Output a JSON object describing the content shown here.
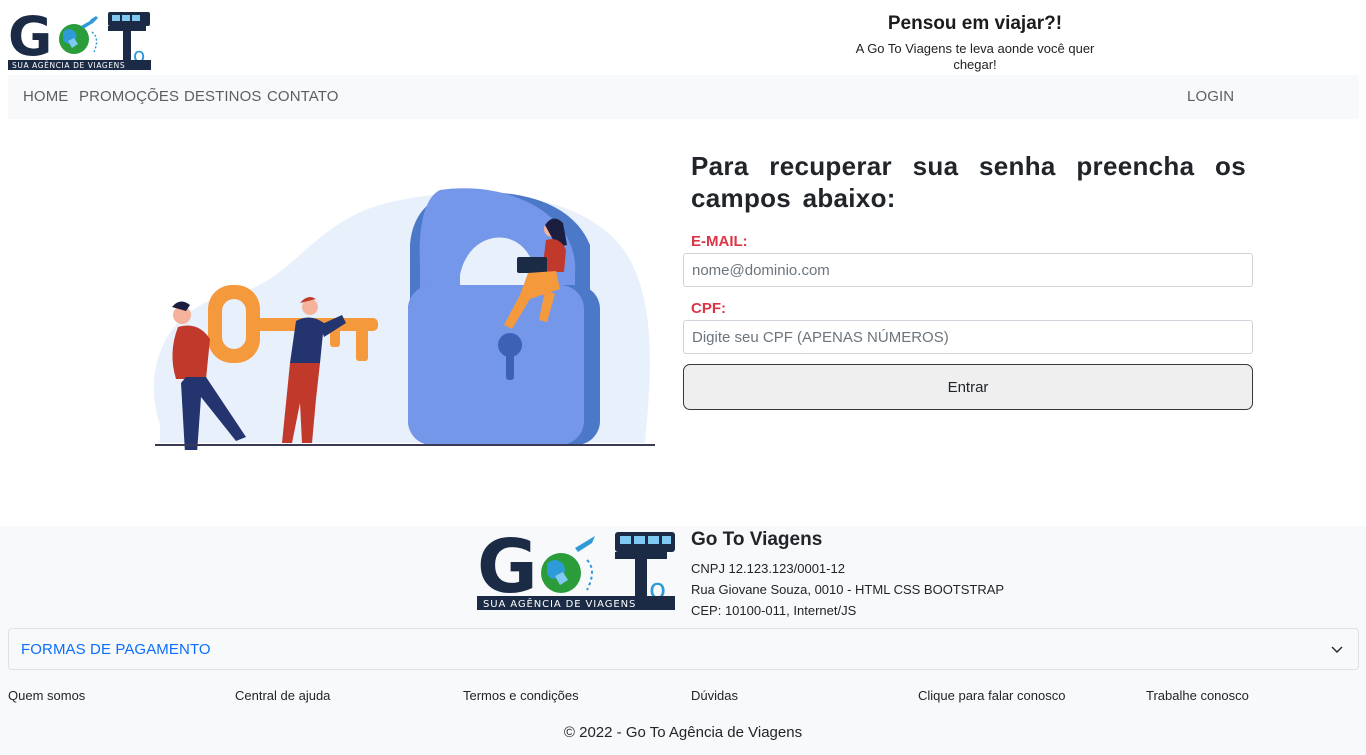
{
  "header": {
    "logo_text": "SUA AGÊNCIA DE VIAGENS",
    "logo_letters": "GoTo",
    "tagline_title": "Pensou em viajar?!",
    "tagline_subtitle": "A Go To Viagens te leva aonde você quer chegar!"
  },
  "nav": {
    "items": [
      "HOME",
      "PROMOÇÕES",
      "DESTINOS",
      "CONTATO"
    ],
    "login": "LOGIN"
  },
  "form": {
    "title": "Para recuperar sua senha preencha os campos abaixo:",
    "email_label": "E-MAIL:",
    "email_placeholder": "nome@dominio.com",
    "cpf_label": "CPF:",
    "cpf_placeholder": "Digite seu CPF (APENAS NÚMEROS)",
    "submit_label": "Entrar"
  },
  "footer": {
    "company_name": "Go To Viagens",
    "cnpj": "CNPJ 12.123.123/0001-12",
    "address": "Rua Giovane Souza, 0010 - HTML CSS BOOTSTRAP",
    "cep": "CEP: 10100-011, Internet/JS",
    "accordion_label": "FORMAS DE PAGAMENTO",
    "links": [
      "Quem somos",
      "Central de ajuda",
      "Termos e condições",
      "Dúvidas",
      "Clique para falar conosco",
      "Trabalhe conosco"
    ],
    "copyright": "© 2022 - Go To Agência de Viagens"
  },
  "colors": {
    "brand_dark": "#1c2b45",
    "brand_blue": "#2e9ad8",
    "brand_green": "#2a9d3a",
    "label_red": "#dc3545",
    "link_blue": "#0d6efd",
    "lock_blue": "#7497ea",
    "key_orange": "#f5993d"
  },
  "icons": [
    "logo-globe-icon",
    "plane-icon",
    "bus-icon",
    "chevron-down-icon"
  ]
}
